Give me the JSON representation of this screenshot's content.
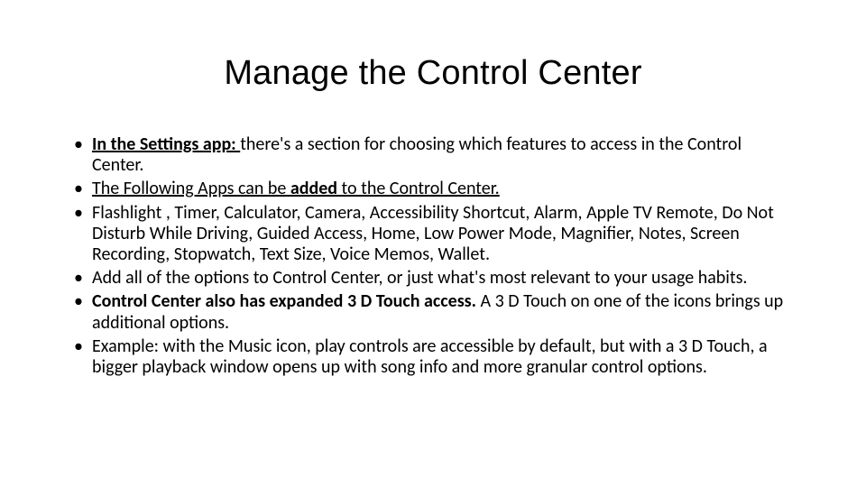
{
  "title": "Manage the Control Center",
  "bullets": {
    "b1_bold": "In the Settings app: ",
    "b1_rest": "there's a section for choosing which features  to  access in the Control Center.",
    "b2_pre": "The Following Apps can be ",
    "b2_bold": "added",
    "b2_post": " to the Control Center.",
    "b3": "Flashlight ,  Timer,  Calculator, Camera, Accessibility Shortcut, Alarm, Apple TV Remote, Do Not Disturb While Driving, Guided Access, Home, Low Power Mode, Magnifier, Notes, Screen Recording, Stopwatch, Text Size, Voice Memos, Wallet.",
    "b4": "Add all of the options to Control Center, or just what's most relevant to your usage habits.",
    "b5_bold": "Control Center also has expanded 3 D Touch access. ",
    "b5_rest": "A 3 D Touch on one of the icons brings up additional options.",
    "b6": "Example: with the Music icon, play controls are accessible by default, but with a 3 D Touch, a bigger playback window opens up with song info and more granular control options."
  }
}
